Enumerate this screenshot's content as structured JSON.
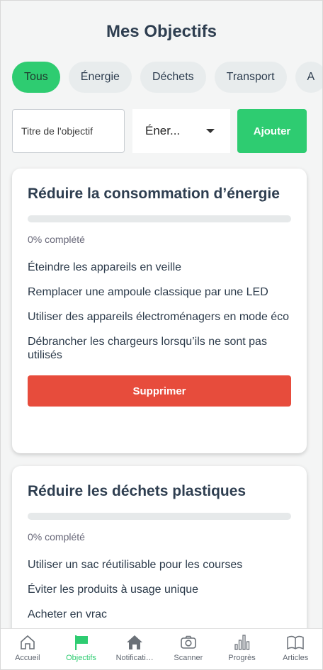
{
  "page": {
    "title": "Mes Objectifs"
  },
  "filters": [
    {
      "label": "Tous",
      "active": true
    },
    {
      "label": "Énergie"
    },
    {
      "label": "Déchets"
    },
    {
      "label": "Transport"
    },
    {
      "label": "A"
    }
  ],
  "form": {
    "title_placeholder": "Titre de l'objectif",
    "category_value": "Éner...",
    "add_label": "Ajouter"
  },
  "goals": [
    {
      "title": "Réduire la consommation d’énergie",
      "progress_text": "0% complété",
      "progress": 0,
      "tasks": [
        "Éteindre les appareils en veille",
        "Remplacer une ampoule classique par une LED",
        "Utiliser des appareils électroménagers en mode éco",
        "Débrancher les chargeurs lorsqu’ils ne sont pas utilisés"
      ],
      "delete_label": "Supprimer"
    },
    {
      "title": "Réduire les déchets plastiques",
      "progress_text": "0% complété",
      "progress": 0,
      "tasks": [
        "Utiliser un sac réutilisable pour les courses",
        "Éviter les produits à usage unique",
        "Acheter en vrac"
      ]
    }
  ],
  "tabs": [
    {
      "label": "Accueil",
      "icon": "home-outline-icon"
    },
    {
      "label": "Objectifs",
      "icon": "flag-icon",
      "active": true
    },
    {
      "label": "Notificati…",
      "icon": "home-filled-icon"
    },
    {
      "label": "Scanner",
      "icon": "camera-icon"
    },
    {
      "label": "Progrès",
      "icon": "bar-chart-icon"
    },
    {
      "label": "Articles",
      "icon": "book-icon"
    }
  ],
  "colors": {
    "accent": "#2ecc71",
    "danger": "#e74c3c",
    "text": "#2e3e50"
  }
}
